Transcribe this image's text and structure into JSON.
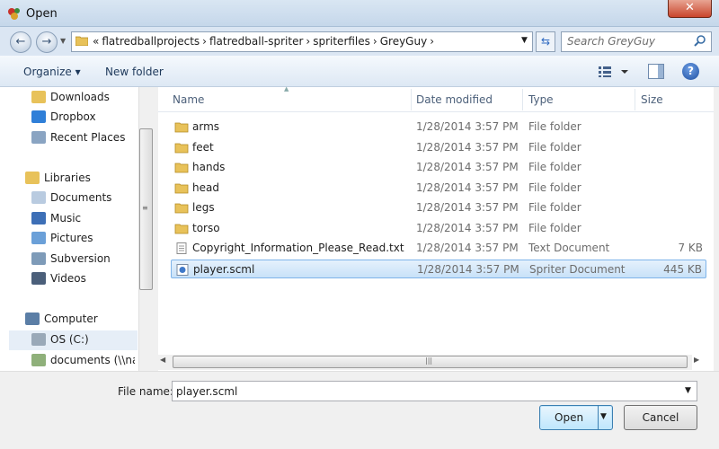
{
  "window": {
    "title": "Open",
    "close_label": "✕"
  },
  "address": {
    "crumbs": [
      "«",
      "flatredballprojects",
      "›",
      "flatredball-spriter",
      "›",
      "spriterfiles",
      "›",
      "GreyGuy",
      "›"
    ],
    "search_placeholder": "Search GreyGuy"
  },
  "toolbar": {
    "organize_label": "Organize ▾",
    "new_folder_label": "New folder",
    "help_label": "?"
  },
  "nav": {
    "items": [
      {
        "label": "Downloads",
        "icon": "downloads-folder-icon"
      },
      {
        "label": "Dropbox",
        "icon": "dropbox-icon"
      },
      {
        "label": "Recent Places",
        "icon": "recent-places-icon"
      },
      {
        "label": "Libraries",
        "icon": "libraries-icon"
      },
      {
        "label": "Documents",
        "icon": "documents-icon"
      },
      {
        "label": "Music",
        "icon": "music-icon"
      },
      {
        "label": "Pictures",
        "icon": "pictures-icon"
      },
      {
        "label": "Subversion",
        "icon": "subversion-icon"
      },
      {
        "label": "Videos",
        "icon": "videos-icon"
      },
      {
        "label": "Computer",
        "icon": "computer-icon"
      },
      {
        "label": "OS (C:)",
        "icon": "drive-icon"
      },
      {
        "label": "documents (\\\\nas",
        "icon": "network-drive-icon"
      }
    ]
  },
  "columns": {
    "name": "Name",
    "date": "Date modified",
    "type": "Type",
    "size": "Size"
  },
  "files": [
    {
      "name": "arms",
      "date": "1/28/2014 3:57 PM",
      "type": "File folder",
      "size": ""
    },
    {
      "name": "feet",
      "date": "1/28/2014 3:57 PM",
      "type": "File folder",
      "size": ""
    },
    {
      "name": "hands",
      "date": "1/28/2014 3:57 PM",
      "type": "File folder",
      "size": ""
    },
    {
      "name": "head",
      "date": "1/28/2014 3:57 PM",
      "type": "File folder",
      "size": ""
    },
    {
      "name": "legs",
      "date": "1/28/2014 3:57 PM",
      "type": "File folder",
      "size": ""
    },
    {
      "name": "torso",
      "date": "1/28/2014 3:57 PM",
      "type": "File folder",
      "size": ""
    },
    {
      "name": "Copyright_Information_Please_Read.txt",
      "date": "1/28/2014 3:57 PM",
      "type": "Text Document",
      "size": "7 KB"
    },
    {
      "name": "player.scml",
      "date": "1/28/2014 3:57 PM",
      "type": "Spriter Document",
      "size": "445 KB"
    }
  ],
  "bottom": {
    "file_name_label": "File name:",
    "file_name_value": "player.scml",
    "open_label": "Open",
    "cancel_label": "Cancel"
  },
  "colors": {
    "accent": "#3c7fb1",
    "selection": "#c8e1f8",
    "folder": "#e8c25a"
  }
}
